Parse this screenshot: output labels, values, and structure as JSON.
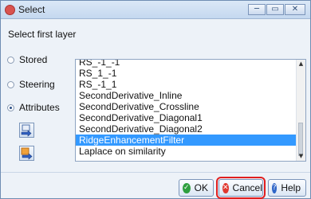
{
  "window": {
    "title": "Select"
  },
  "dialog": {
    "prompt": "Select first layer"
  },
  "source_options": [
    {
      "label": "Stored",
      "checked": false
    },
    {
      "label": "Steering",
      "checked": false
    },
    {
      "label": "Attributes",
      "checked": true
    }
  ],
  "side_buttons": [
    {
      "icon": "import-icon"
    },
    {
      "icon": "export-icon"
    }
  ],
  "layer_list": {
    "items": [
      "RS_-1_-1",
      "RS_1_-1",
      "RS_-1_1",
      "SecondDerivative_Inline",
      "SecondDerivative_Crossline",
      "SecondDerivative_Diagonal1",
      "SecondDerivative_Diagonal2",
      "RidgeEnhancementFilter",
      "Laplace on similarity"
    ],
    "selected": "RidgeEnhancementFilter"
  },
  "buttons": {
    "ok": "OK",
    "cancel": "Cancel",
    "help": "Help"
  },
  "colors": {
    "selection": "#3399ff",
    "highlight_border": "#e01f1f",
    "ok_icon": "#2e9f3f",
    "cancel_icon": "#e0382f",
    "help_icon": "#2f66c8"
  }
}
